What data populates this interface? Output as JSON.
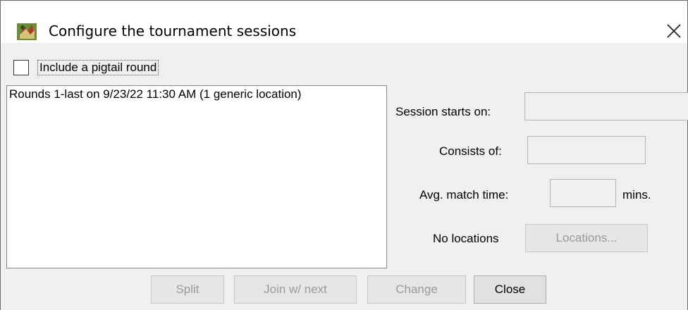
{
  "window": {
    "title": "Configure the tournament sessions",
    "close_glyph": "✕"
  },
  "options": {
    "pigtail_label": "Include a pigtail round",
    "pigtail_checked": false
  },
  "sessions": {
    "items": [
      "Rounds 1-last on 9/23/22 11:30 AM (1 generic location)"
    ]
  },
  "details": {
    "starts_on_label": "Session starts on:",
    "starts_on_value": "",
    "consists_of_label": "Consists of:",
    "consists_of_value": "",
    "avg_match_label": "Avg. match time:",
    "avg_match_value": "",
    "avg_match_unit": "mins.",
    "locations_status": "No locations",
    "locations_button": "Locations..."
  },
  "buttons": {
    "split": "Split",
    "join": "Join w/ next",
    "change": "Change",
    "close": "Close"
  }
}
